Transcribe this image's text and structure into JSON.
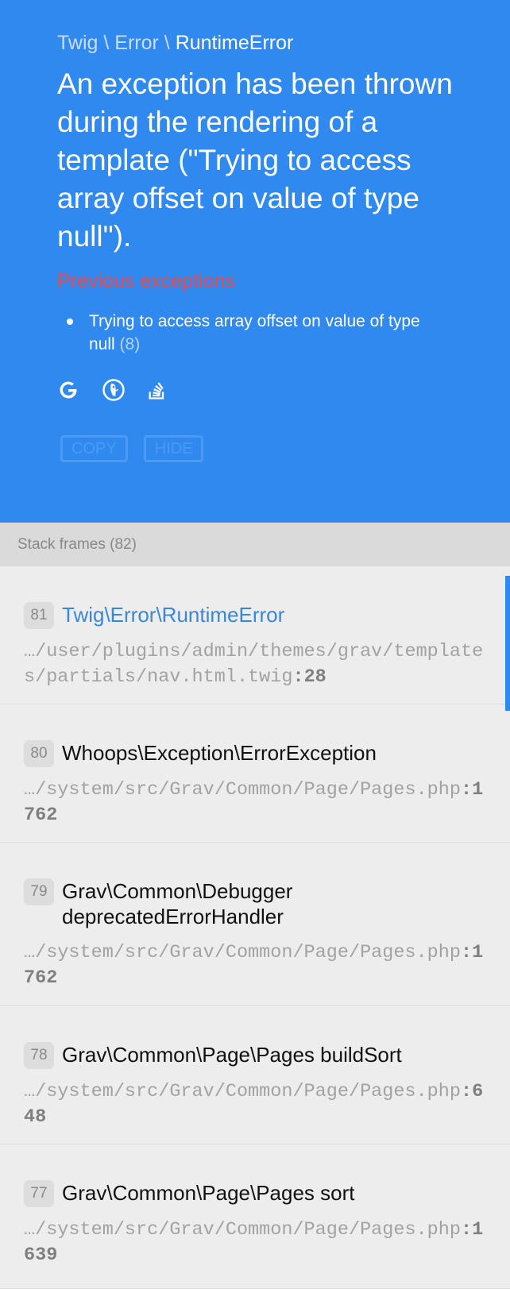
{
  "header": {
    "path": [
      "Twig",
      "Error",
      "RuntimeError"
    ],
    "path_separator": "\\",
    "message": "An exception has been thrown during the rendering of a template (\"Trying to access array offset on value of type null\").",
    "previous_title": "Previous exceptions",
    "previous": [
      {
        "text": "Trying to access array offset on value of type null",
        "count": "(8)"
      }
    ],
    "search_icons": [
      "google-icon",
      "duckduckgo-icon",
      "stackoverflow-icon"
    ],
    "buttons": {
      "copy": "COPY",
      "hide": "HIDE"
    }
  },
  "frames_header": "Stack frames (82)",
  "frames": [
    {
      "num": "81",
      "cls": "Twig\\Error\\RuntimeError",
      "file": "…/user/plugins/admin/themes/grav/templates/partials/nav.html.twig",
      "line": ":28",
      "active": true
    },
    {
      "num": "80",
      "cls": "Whoops\\Exception\\ErrorException",
      "file": "…/system/src/Grav/Common/Page/Pages.php",
      "line": ":1762"
    },
    {
      "num": "79",
      "cls": "Grav\\Common\\Debugger deprecatedErrorHandler",
      "file": "…/system/src/Grav/Common/Page/Pages.php",
      "line": ":1762"
    },
    {
      "num": "78",
      "cls": "Grav\\Common\\Page\\Pages buildSort",
      "file": "…/system/src/Grav/Common/Page/Pages.php",
      "line": ":648"
    },
    {
      "num": "77",
      "cls": "Grav\\Common\\Page\\Pages sort",
      "file": "…/system/src/Grav/Common/Page/Pages.php",
      "line": ":1639"
    }
  ],
  "colors": {
    "header_bg": "#3089ef",
    "previous_title": "#f0494b",
    "active_class": "#3c87d3"
  }
}
